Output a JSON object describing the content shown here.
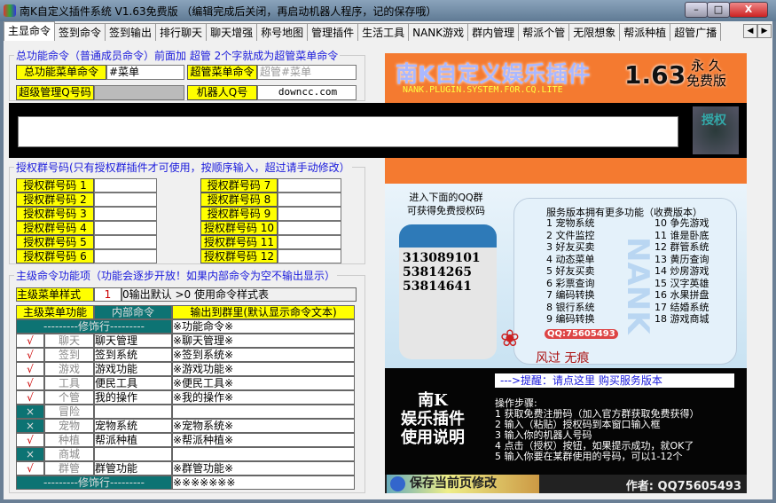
{
  "window": {
    "title": "南K自定义插件系统 V1.63免费版 （编辑完成后关闭，再启动机器人程序，记的保存哦）",
    "min": "–",
    "max": "□",
    "close": "X"
  },
  "tabs": [
    "主显命令",
    "签到命令",
    "签到输出",
    "排行聊天",
    "聊天增强",
    "称号地图",
    "管理插件",
    "生活工具",
    "NANK游戏",
    "群内管理",
    "帮派个管",
    "无限想象",
    "帮派种植",
    "超管广播"
  ],
  "tab_arrows": [
    "◀",
    "▶"
  ],
  "group1": {
    "title": "总功能命令（普通成员命令）前面加 超管 2个字就成为超管菜单命令",
    "menu_label": "总功能菜单命令",
    "menu_value": "#菜单",
    "admin_menu_label": "超管菜单命令",
    "admin_menu_placeholder": "超管#菜单",
    "super_qq_label": "超级管理Q号码",
    "super_qq_value": "",
    "robot_qq_label": "机器人Q号",
    "robot_qq_value": "downcc.com"
  },
  "auth": {
    "code_value": "",
    "button": "授权"
  },
  "group2": {
    "title": "授权群号码(只有授权群插件才可使用，按顺序输入，超过请手动修改）",
    "labels": [
      "授权群号码 1",
      "授权群号码 2",
      "授权群号码 3",
      "授权群号码 4",
      "授权群号码 5",
      "授权群号码 6",
      "授权群号码 7",
      "授权群号码 8",
      "授权群号码 9",
      "授权群号码 10",
      "授权群号码 11",
      "授权群号码 12"
    ],
    "values": [
      "",
      "",
      "",
      "",
      "",
      "",
      "",
      "",
      "",
      "",
      "",
      ""
    ]
  },
  "group3": {
    "title": "主级命令功能项（功能会逐步开放！如果内部命令为空不输出显示）",
    "style_label": "主级菜单样式",
    "style_value": "1",
    "style_hint": "0输出默认 >0 使用命令样式表",
    "headers": [
      "主级菜单功能",
      "内部命令",
      "输出到群里(默认显示命令文本)"
    ],
    "deco": "---------修饰行---------",
    "first_out": "※功能命令※",
    "last_out": "※※※※※※※",
    "rows": [
      {
        "on": true,
        "mark": "√",
        "name": "聊天",
        "cmd": "聊天管理",
        "out": "※聊天管理※"
      },
      {
        "on": true,
        "mark": "√",
        "name": "签到",
        "cmd": "签到系统",
        "out": "※签到系统※"
      },
      {
        "on": true,
        "mark": "√",
        "name": "游戏",
        "cmd": "游戏功能",
        "out": "※游戏功能※"
      },
      {
        "on": true,
        "mark": "√",
        "name": "工具",
        "cmd": "便民工具",
        "out": "※便民工具※"
      },
      {
        "on": true,
        "mark": "√",
        "name": "个管",
        "cmd": "我的操作",
        "out": "※我的操作※"
      },
      {
        "on": false,
        "mark": "×",
        "name": "冒险",
        "cmd": "",
        "out": ""
      },
      {
        "on": false,
        "mark": "×",
        "name": "宠物",
        "cmd": "宠物系统",
        "out": "※宠物系统※"
      },
      {
        "on": true,
        "mark": "√",
        "name": "种植",
        "cmd": "帮派种植",
        "out": "※帮派种植※"
      },
      {
        "on": false,
        "mark": "×",
        "name": "商城",
        "cmd": "",
        "out": ""
      },
      {
        "on": true,
        "mark": "√",
        "name": "群管",
        "cmd": "群管功能",
        "out": "※群管功能※"
      }
    ]
  },
  "banner": {
    "title": "南K自定义娱乐插件",
    "subtitle": "NANK.PLUGIN.SYSTEM.FOR.CQ.LITE",
    "version": "1.63",
    "perm1": "永 久",
    "perm2": "免费版"
  },
  "promo": {
    "qq_intro1": "进入下面的QQ群",
    "qq_intro2": "可获得免费授权码",
    "groups": [
      "313089101",
      "53814265",
      "53814641"
    ],
    "service_title": "服务版本拥有更多功能（收费版本）",
    "features_left": [
      "1 宠物系统",
      "2 文件监控",
      "3 好友买卖",
      "4 动态菜单",
      "5 好友买卖",
      "6 彩票查询",
      "7 编码转换",
      "8 银行系统",
      "9 编码转换"
    ],
    "features_right": [
      "10 争先游戏",
      "11 谁是卧底",
      "12 群管系统",
      "13 黄历查询",
      "14 炒房游戏",
      "15 汉字英雄",
      "16 水果拼盘",
      "17 结婚系统",
      "18 游戏商城"
    ],
    "watermark": "NANK",
    "qq_stamp": "QQ:75605493",
    "logo_text": "风过 无痕"
  },
  "guide": {
    "reminder": "--->提醒：请点这里 购买服务版本",
    "big1": "南K",
    "big2": "娱乐插件",
    "big3": "使用说明",
    "steps_title": "操作步骤:",
    "steps": [
      "1 获取免费注册码（加入官方群获取免费获得）",
      "2 输入（粘贴）授权码到本窗口输入框",
      "3 输入你的机器人号码",
      "4 点击（授权）按钮，如果提示成功，就OK了",
      "5 输入你要在某群使用的号码，可以1-12个"
    ],
    "save": "保存当前页修改",
    "author": "作者: QQ75605493"
  },
  "colors": {
    "accent_orange": "#f47a30",
    "label_yellow": "#ffff00",
    "teal": "#0d7373",
    "link_blue": "#1a1adc"
  }
}
